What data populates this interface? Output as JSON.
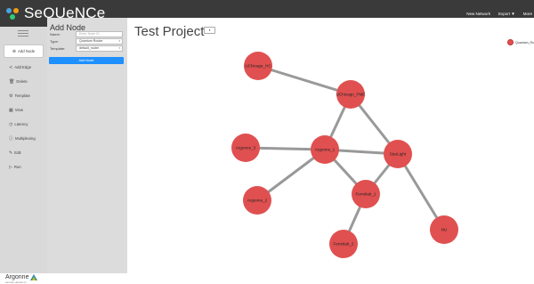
{
  "app": {
    "brand": "SeQUeNCe",
    "nav": {
      "new_network": "New Network",
      "export": "Export",
      "more": "More"
    }
  },
  "sidebar": {
    "items": [
      {
        "label": "Add Node",
        "icon": "plus-circle-icon",
        "active": true
      },
      {
        "label": "Add Edge",
        "icon": "share-icon"
      },
      {
        "label": "Delete",
        "icon": "trash-icon"
      },
      {
        "label": "Template",
        "icon": "cog-icon"
      },
      {
        "label": "View",
        "icon": "table-icon"
      },
      {
        "label": "Latency",
        "icon": "clock-icon"
      },
      {
        "label": "Multiplexing",
        "icon": "info-circle-icon"
      },
      {
        "label": "Edit",
        "icon": "edit-icon"
      },
      {
        "label": "Run",
        "icon": "play-icon"
      }
    ],
    "footer_logo": "Argonne",
    "footer_sub": "NATIONAL LABORATORY"
  },
  "panel": {
    "title": "Add Node",
    "name_label": "Name:",
    "name_placeholder": "Enter Node ID",
    "type_label": "Type:",
    "type_value": "Quantum Router",
    "template_label": "Template:",
    "template_value": "default_router",
    "add_button": "Add Node"
  },
  "main": {
    "project_title": "Test Project",
    "small_button": "⏵",
    "legend_label": "Quantum_Ro",
    "colors": {
      "node_fill": "#e05050",
      "edge": "#999999"
    }
  },
  "graph": {
    "nodes": [
      {
        "id": "UChicago_HC"
      },
      {
        "id": "UChicago_PME"
      },
      {
        "id": "Argonne_3"
      },
      {
        "id": "Argonne_1"
      },
      {
        "id": "StarLight"
      },
      {
        "id": "Argonne_2"
      },
      {
        "id": "Fermilab_1"
      },
      {
        "id": "Fermilab_2"
      },
      {
        "id": "NU"
      }
    ],
    "edges": [
      [
        "UChicago_HC",
        "UChicago_PME"
      ],
      [
        "UChicago_PME",
        "Argonne_1"
      ],
      [
        "UChicago_PME",
        "StarLight"
      ],
      [
        "Argonne_3",
        "Argonne_1"
      ],
      [
        "Argonne_1",
        "StarLight"
      ],
      [
        "Argonne_1",
        "Argonne_2"
      ],
      [
        "Argonne_1",
        "Fermilab_1"
      ],
      [
        "StarLight",
        "Fermilab_1"
      ],
      [
        "StarLight",
        "NU"
      ],
      [
        "Fermilab_1",
        "Fermilab_2"
      ]
    ]
  }
}
